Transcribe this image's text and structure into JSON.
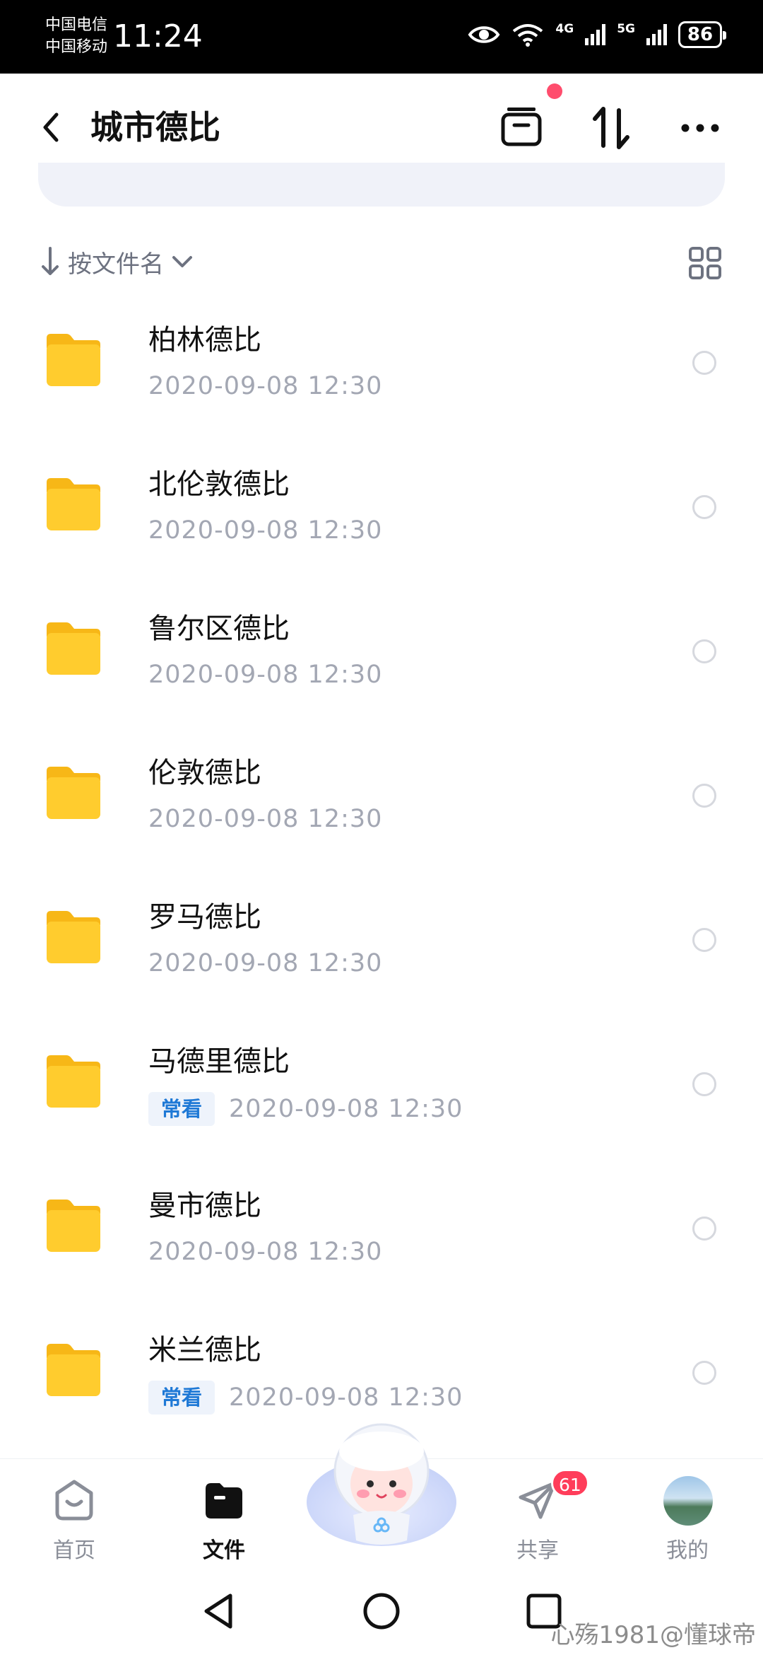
{
  "status_bar": {
    "carrier_1": "中国电信",
    "carrier_2": "中国移动",
    "time": "11:24",
    "net_1": "4G",
    "net_2": "5G",
    "battery": "86"
  },
  "header": {
    "title": "城市德比"
  },
  "sort": {
    "label": "按文件名"
  },
  "files": [
    {
      "name": "柏林德比",
      "time": "2020-09-08  12:30",
      "badge": ""
    },
    {
      "name": "北伦敦德比",
      "time": "2020-09-08  12:30",
      "badge": ""
    },
    {
      "name": "鲁尔区德比",
      "time": "2020-09-08  12:30",
      "badge": ""
    },
    {
      "name": "伦敦德比",
      "time": "2020-09-08  12:30",
      "badge": ""
    },
    {
      "name": "罗马德比",
      "time": "2020-09-08  12:30",
      "badge": ""
    },
    {
      "name": "马德里德比",
      "time": "2020-09-08  12:30",
      "badge": "常看"
    },
    {
      "name": "曼市德比",
      "time": "2020-09-08  12:30",
      "badge": ""
    },
    {
      "name": "米兰德比",
      "time": "2020-09-08  12:30",
      "badge": "常看"
    }
  ],
  "bottom_nav": {
    "home": "首页",
    "files": "文件",
    "share": "共享",
    "share_badge": "61",
    "me": "我的"
  },
  "watermark": "心殇1981@懂球帝",
  "colors": {
    "folder": "#ffc928",
    "badge_text": "#1f79d6",
    "notification": "#ff3d5a"
  },
  "icons": {
    "back": "back-arrow-icon",
    "archive": "archive-box-icon",
    "sort": "sort-arrows-icon",
    "more": "more-dots-icon",
    "grid": "grid-view-icon"
  }
}
